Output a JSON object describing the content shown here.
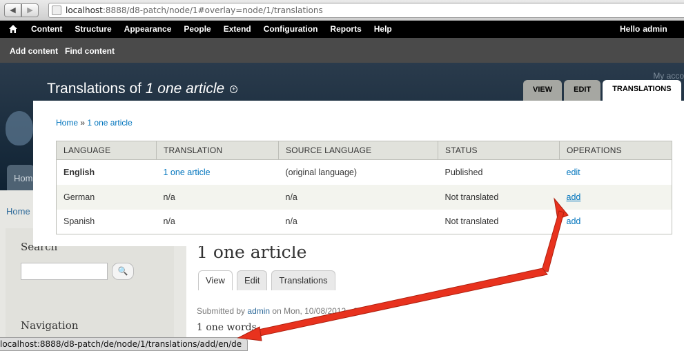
{
  "browser": {
    "url_host": "localhost",
    "url_rest": ":8888/d8-patch/node/1#overlay=node/1/translations"
  },
  "toolbar": {
    "menu": [
      "Content",
      "Structure",
      "Appearance",
      "People",
      "Extend",
      "Configuration",
      "Reports",
      "Help"
    ],
    "greeting": "Hello",
    "username": "admin"
  },
  "shortcuts": {
    "items": [
      "Add content",
      "Find content"
    ]
  },
  "background_page": {
    "my_account": "My acco",
    "home_tab": "Home",
    "breadcrumb": "Home",
    "search_title": "Search",
    "navigation_title": "Navigation",
    "node_title": "1 one article",
    "tabs": [
      "View",
      "Edit",
      "Translations"
    ],
    "submitted_prefix": "Submitted by",
    "submitted_author": "admin",
    "submitted_date": "on Mon, 10/08/2012 - 21",
    "body_text": "1 one words"
  },
  "overlay": {
    "title_prefix": "Translations of",
    "title_node": "1 one article",
    "tabs": [
      "VIEW",
      "EDIT",
      "TRANSLATIONS"
    ],
    "breadcrumb": {
      "home": "Home",
      "separator": "»",
      "node": "1 one article"
    }
  },
  "translations_table": {
    "headers": [
      "LANGUAGE",
      "TRANSLATION",
      "SOURCE LANGUAGE",
      "STATUS",
      "OPERATIONS"
    ],
    "rows": [
      {
        "language": "English",
        "translation": "1 one article",
        "source": "(original language)",
        "status": "Published",
        "operation": "edit"
      },
      {
        "language": "German",
        "translation": "n/a",
        "source": "n/a",
        "status": "Not translated",
        "operation": "add"
      },
      {
        "language": "Spanish",
        "translation": "n/a",
        "source": "n/a",
        "status": "Not translated",
        "operation": "add"
      }
    ]
  },
  "status_bar": {
    "link_url": "localhost:8888/d8-patch/de/node/1/translations/add/en/de"
  },
  "colors": {
    "toolbar_bg": "#000000",
    "shortcuts_bg": "#4a4a4a",
    "link": "#0074bd",
    "annotation_arrow": "#e8321e"
  }
}
